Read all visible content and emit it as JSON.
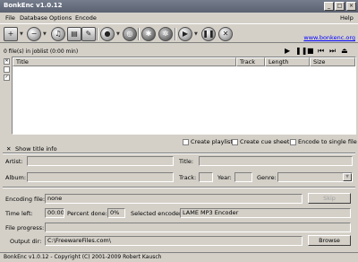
{
  "window": {
    "title": "BonkEnc v1.0.12",
    "min": "_",
    "max": "□",
    "close": "×"
  },
  "menu": {
    "file": "File",
    "database": "Database",
    "options": "Options",
    "encode": "Encode",
    "help": "Help"
  },
  "joblist": {
    "info": "0 file(s) in joblist (0:00 min)",
    "columns": {
      "title": "Title",
      "track": "Track",
      "length": "Length",
      "size": "Size"
    }
  },
  "link": "www.bonkenc.org",
  "options": {
    "create_playlist": "Create playlist",
    "create_cue_sheet": "Create cue sheet",
    "encode_single_file": "Encode to single file",
    "show_title_info": "Show title info"
  },
  "titleinfo": {
    "artist": "Artist:",
    "title": "Title:",
    "album": "Album:",
    "track": "Track:",
    "year": "Year:",
    "genre": "Genre:"
  },
  "encoding": {
    "file_label": "Encoding file:",
    "file_value": "none",
    "skip": "Skip",
    "time_left_label": "Time left:",
    "time_left_value": "00:00",
    "percent_label": "Percent done:",
    "percent_value": "0%",
    "encoder_label": "Selected encoder:",
    "encoder_value": "LAME MP3 Encoder",
    "progress_label": "File progress:",
    "progress_value": 0,
    "output_label": "Output dir:",
    "output_value": "C:\\FreewareFiles.com\\",
    "browse": "Browse"
  },
  "status": "BonkEnc v1.0.12 - Copyright (C) 2001-2009 Robert Kausch"
}
